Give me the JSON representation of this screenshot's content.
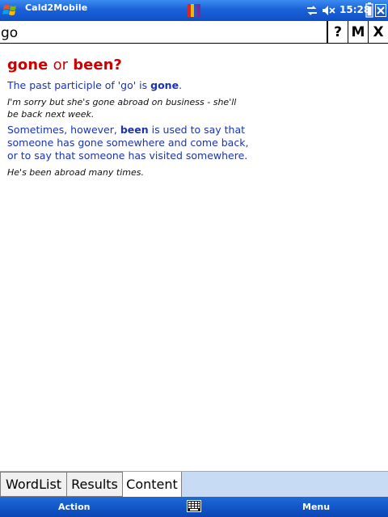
{
  "titlebar": {
    "app_title": "Cald2Mobile",
    "clock": "15:28"
  },
  "search": {
    "value": "go",
    "buttons": {
      "help": "?",
      "m": "M",
      "x": "X"
    }
  },
  "entry": {
    "title_word1": "gone",
    "title_or": "or",
    "title_word2": "been?",
    "def1_pre": "The past participle of 'go' is ",
    "def1_bold": "gone",
    "def1_post": ".",
    "example1": "I'm sorry but she's gone abroad on business - she'll be back next week.",
    "def2_pre": "Sometimes, however, ",
    "def2_bold": "been",
    "def2_post": " is used to say that someone has gone somewhere and come back, or to say that someone has visited somewhere.",
    "example2": "He's been abroad many times."
  },
  "tabs": [
    "WordList",
    "Results",
    "Content"
  ],
  "selected_tab": "Content",
  "softkeys": {
    "left": "Action",
    "right": "Menu"
  },
  "icons": {
    "start": "windows-start-icon",
    "app": "book-icon",
    "sync": "sync-icon",
    "volume": "volume-muted-icon",
    "battery": "battery-icon",
    "close": "close-icon",
    "keyboard": "keyboard-icon"
  },
  "colors": {
    "title_bar": "#1b62d8",
    "headword": "#cc0000",
    "definition": "#1a33b5",
    "tab_strip": "#c7dcf4"
  }
}
